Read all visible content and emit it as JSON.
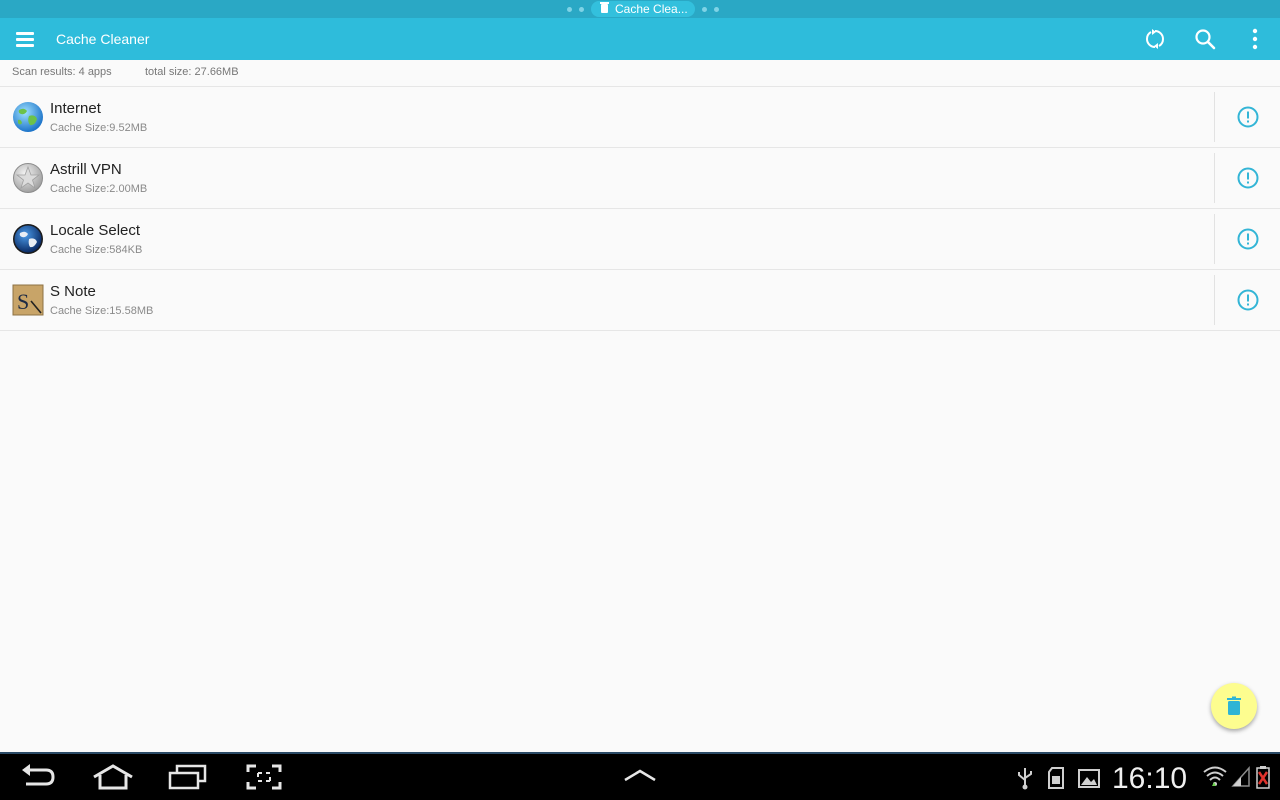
{
  "tab_strip": {
    "tab_label": "Cache Clea..."
  },
  "app_bar": {
    "title": "Cache Cleaner",
    "actions": [
      "refresh-icon",
      "search-icon",
      "overflow-menu-icon"
    ]
  },
  "summary": {
    "scan_results": "Scan results: 4 apps",
    "total_size": "total size: 27.66MB"
  },
  "apps": [
    {
      "name": "Internet",
      "cache": "Cache Size:9.52MB",
      "icon": "internet-globe-icon"
    },
    {
      "name": "Astrill VPN",
      "cache": "Cache Size:2.00MB",
      "icon": "astrill-star-icon"
    },
    {
      "name": "Locale Select",
      "cache": "Cache Size:584KB",
      "icon": "locale-globe-icon"
    },
    {
      "name": "S Note",
      "cache": "Cache Size:15.58MB",
      "icon": "s-note-icon"
    }
  ],
  "fab": {
    "icon": "trash-icon"
  },
  "system_bar": {
    "time": "16:10",
    "buttons": [
      "back-icon",
      "home-icon",
      "recent-apps-icon",
      "screenshot-icon",
      "up-chevron-icon"
    ],
    "status_icons": [
      "usb-icon",
      "sd-card-icon",
      "gallery-icon",
      "wifi-icon",
      "signal-icon",
      "battery-icon"
    ]
  },
  "colors": {
    "primary": "#2ebcdb",
    "primary_dark": "#2aa8c5",
    "fab": "#fdfd8f",
    "info_icon": "#33b5d6"
  }
}
